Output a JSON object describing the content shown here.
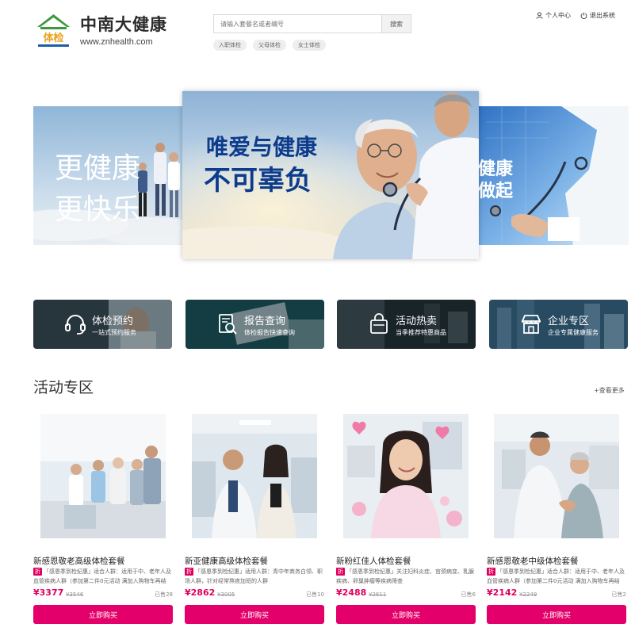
{
  "brand": {
    "logo_text": "体检",
    "name": "中南大健康",
    "url": "www.znhealth.com"
  },
  "search": {
    "placeholder": "请输入套餐名或者编号",
    "button": "搜索",
    "hot_tags": [
      "入职体检",
      "父母体检",
      "女士体检"
    ]
  },
  "user_links": {
    "profile": "个人中心",
    "logout": "退出系统"
  },
  "carousel": {
    "left": {
      "line1": "更健康",
      "line2": "更快乐"
    },
    "main": {
      "line1": "唯爱与健康",
      "line2": "不可辜负"
    },
    "right": {
      "line1": "健康",
      "line2": "做起"
    }
  },
  "services": [
    {
      "title": "体检预约",
      "subtitle": "一站式预约服务",
      "icon": "headset-icon"
    },
    {
      "title": "报告查询",
      "subtitle": "体检报告快速查询",
      "icon": "report-search-icon"
    },
    {
      "title": "活动热卖",
      "subtitle": "当季推荐特惠商品",
      "icon": "shopping-bag-icon"
    },
    {
      "title": "企业专区",
      "subtitle": "企业专属健康服务",
      "icon": "store-icon"
    }
  ],
  "activity": {
    "title": "活动专区",
    "more": "+查看更多",
    "products": [
      {
        "name": "新感恩敬老高级体检套餐",
        "badge": "折",
        "desc": "「感恩季到检纪惠」适合人群：适用于中、老年人及血管疾病人群（参加第二件0元活动 满加入购物车再结算）",
        "price": "¥3377",
        "orig": "¥3546",
        "sold": "已售28",
        "button": "立即购买"
      },
      {
        "name": "新亚健康高级体检套餐",
        "badge": "折",
        "desc": "「感恩季到检纪惠」适用人群：青中年商务白领、职场人群，针对经常熬夜加班的人群",
        "price": "¥2862",
        "orig": "¥3005",
        "sold": "已售10",
        "button": "立即购买"
      },
      {
        "name": "新粉红佳人体检套餐",
        "badge": "折",
        "desc": "「感恩季到检纪惠」关注妇科炎症、宫颈病变、乳腺疾病、卵巢肿瘤等疾病筛查",
        "price": "¥2488",
        "orig": "¥2611",
        "sold": "已售6",
        "button": "立即购买"
      },
      {
        "name": "新感恩敬老中级体检套餐",
        "badge": "折",
        "desc": "「感恩季到检纪惠」适合人群：适用于中、老年人及血管疾病人群（参加第二件0元活动 满加入购物车再结算）",
        "price": "¥2142",
        "orig": "¥2249",
        "sold": "已售2",
        "button": "立即购买"
      }
    ]
  },
  "colors": {
    "accent": "#e4006a",
    "brand_green": "#3a9a3a",
    "brand_blue": "#0d3c8c"
  }
}
